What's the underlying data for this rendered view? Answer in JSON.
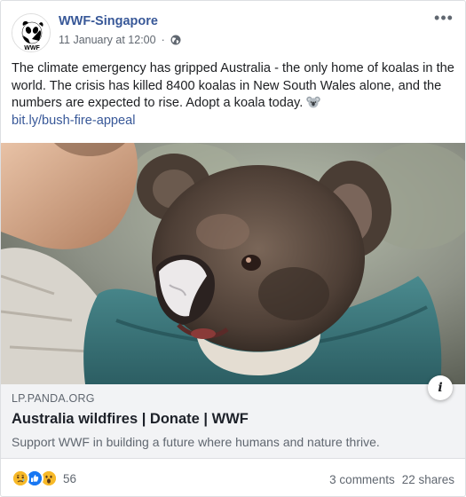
{
  "post": {
    "page_name": "WWF-Singapore",
    "timestamp": "11 January at 12:00",
    "timestamp_separator": "·",
    "more_menu": "•••",
    "message_text": "The climate emergency has gripped Australia - the only home of koalas in the world. The crisis has killed 8400 koalas in New South Wales alone, and the numbers are expected to rise. Adopt a koala today.",
    "message_link": "bit.ly/bush-fire-appeal",
    "avatar_logo_text": "WWF"
  },
  "link_preview": {
    "domain": "LP.PANDA.ORG",
    "title": "Australia wildfires | Donate | WWF",
    "description": "Support WWF in building a future where humans and nature thrive.",
    "info_button": "i"
  },
  "footer": {
    "reaction_icons": [
      "sad-reaction-icon",
      "like-reaction-icon",
      "wow-reaction-icon"
    ],
    "reaction_count": "56",
    "comments": "3 comments",
    "shares": "22 shares"
  },
  "colors": {
    "link_blue": "#385898",
    "secondary_text": "#606770",
    "link_box_bg": "#f2f3f5",
    "like_blue": "#1877f2",
    "reaction_yellow": "#f7b928"
  }
}
